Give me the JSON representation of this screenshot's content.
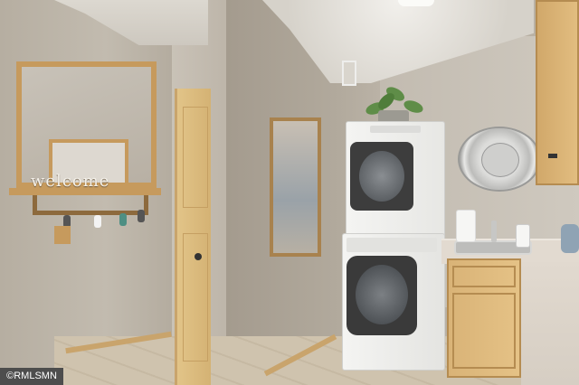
{
  "sign": {
    "text": "welcome"
  },
  "watermark": {
    "text": "©RMLSMN"
  },
  "colors": {
    "wall": "#b6aea1",
    "wood": "#c69a5d",
    "appliance": "#f4f4f2"
  }
}
